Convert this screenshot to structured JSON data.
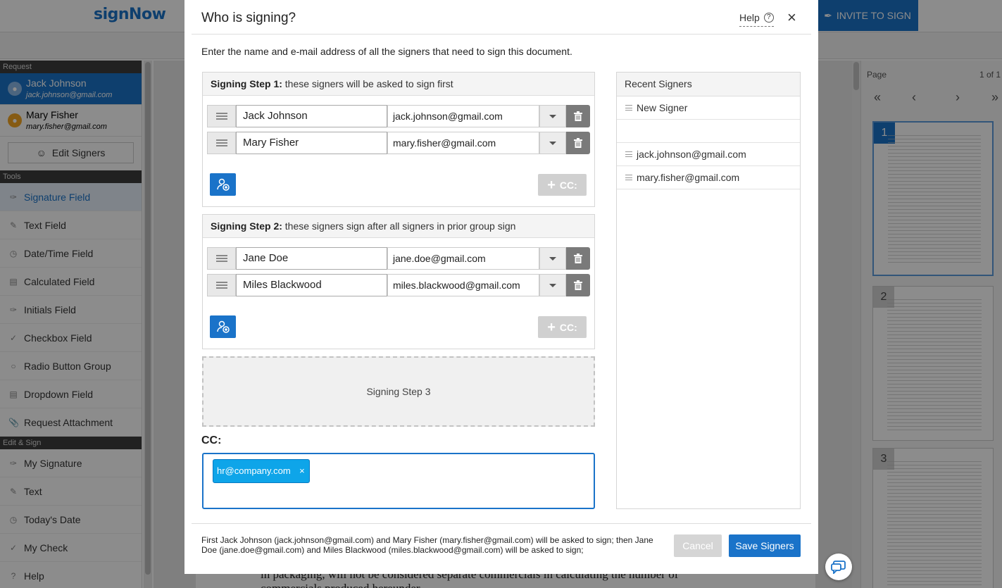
{
  "app": {
    "logo": "signNow",
    "invite_label": "INVITE TO SIGN",
    "sections": {
      "request": "Request",
      "tools": "Tools",
      "edit_sign": "Edit & Sign"
    },
    "signers": [
      {
        "name": "Jack Johnson",
        "email": "jack.johnson@gmail.com"
      },
      {
        "name": "Mary Fisher",
        "email": "mary.fisher@gmail.com"
      }
    ],
    "edit_signers_label": "Edit Signers",
    "tools": [
      {
        "label": "Signature Field",
        "icon": "pen-icon"
      },
      {
        "label": "Text Field",
        "icon": "pencil-icon"
      },
      {
        "label": "Date/Time Field",
        "icon": "clock-icon"
      },
      {
        "label": "Calculated Field",
        "icon": "calculator-icon"
      },
      {
        "label": "Initials Field",
        "icon": "pen-icon"
      },
      {
        "label": "Checkbox Field",
        "icon": "check-icon"
      },
      {
        "label": "Radio Button Group",
        "icon": "radio-icon"
      },
      {
        "label": "Dropdown Field",
        "icon": "list-icon"
      },
      {
        "label": "Request Attachment",
        "icon": "paperclip-icon"
      }
    ],
    "edit_tools": [
      {
        "label": "My Signature",
        "icon": "pen-icon"
      },
      {
        "label": "Text",
        "icon": "pencil-icon"
      },
      {
        "label": "Today's Date",
        "icon": "clock-icon"
      },
      {
        "label": "My Check",
        "icon": "check-icon"
      },
      {
        "label": "Help",
        "icon": "help-icon"
      }
    ],
    "page_label": "Page",
    "page_count": "1 of 1",
    "thumbnails": [
      "1",
      "2",
      "3"
    ],
    "doc_lines": [
      "in packaging, will not be considered separate commercials in calculating the number of",
      "commercials produced hereunder."
    ]
  },
  "modal": {
    "title": "Who is signing?",
    "help_label": "Help",
    "close_label": "×",
    "intro": "Enter the name and e-mail address of all the signers that need to sign this document.",
    "steps": [
      {
        "title": "Signing Step 1:",
        "subtitle": " these signers will be asked to sign first",
        "signers": [
          {
            "name": "Jack Johnson",
            "email": "jack.johnson@gmail.com"
          },
          {
            "name": "Mary Fisher",
            "email": "mary.fisher@gmail.com"
          }
        ],
        "cc_label": "CC:"
      },
      {
        "title": "Signing Step 2:",
        "subtitle": " these signers sign after all signers in prior group sign",
        "signers": [
          {
            "name": "Jane Doe",
            "email": "jane.doe@gmail.com"
          },
          {
            "name": "Miles Blackwood",
            "email": "miles.blackwood@gmail.com"
          }
        ],
        "cc_label": "CC:"
      }
    ],
    "step3_label": "Signing Step 3",
    "cc_title": "CC:",
    "cc_tags": [
      "hr@company.com"
    ],
    "recent": {
      "title": "Recent Signers",
      "items": [
        "New Signer",
        "",
        "jack.johnson@gmail.com",
        "mary.fisher@gmail.com"
      ]
    },
    "summary": "First Jack Johnson (jack.johnson@gmail.com) and Mary Fisher (mary.fisher@gmail.com) will be asked to sign; then Jane Doe (jane.doe@gmail.com) and Miles Blackwood (miles.blackwood@gmail.com) will be asked to sign;",
    "cancel_label": "Cancel",
    "save_label": "Save Signers"
  }
}
